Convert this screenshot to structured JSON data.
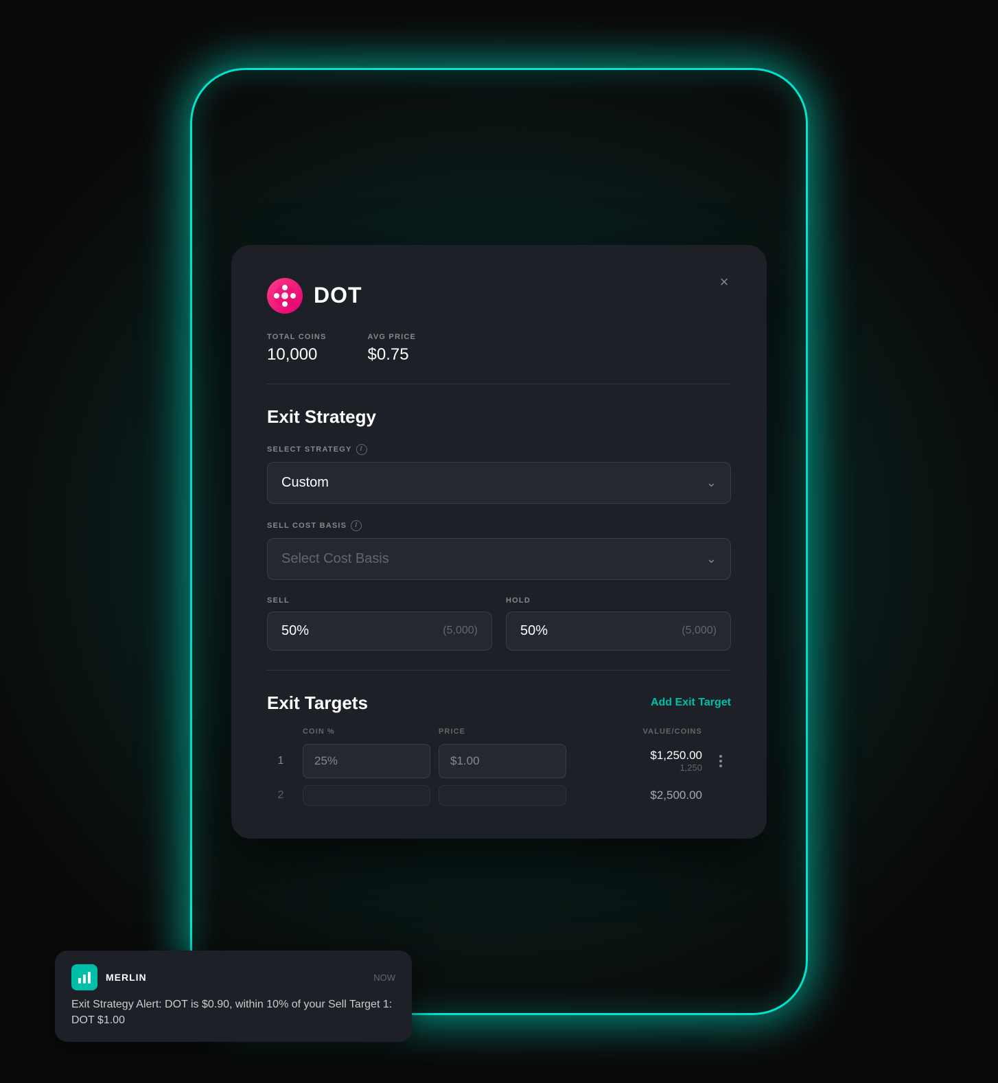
{
  "background": {
    "glow_color": "#00e5cc"
  },
  "modal": {
    "coin": {
      "name": "DOT",
      "logo_alt": "DOT coin logo"
    },
    "stats": {
      "total_coins_label": "TOTAL COINS",
      "total_coins_value": "10,000",
      "avg_price_label": "AVG PRICE",
      "avg_price_value": "$0.75"
    },
    "exit_strategy": {
      "section_title": "Exit Strategy",
      "select_strategy_label": "SELECT STRATEGY",
      "select_strategy_info": "i",
      "strategy_selected": "Custom",
      "sell_cost_basis_label": "SELL COST BASIS",
      "sell_cost_basis_info": "i",
      "cost_basis_placeholder": "Select Cost Basis",
      "sell_label": "SELL",
      "sell_value": "50%",
      "sell_coins": "(5,000)",
      "hold_label": "HOLD",
      "hold_value": "50%",
      "hold_coins": "(5,000)"
    },
    "exit_targets": {
      "section_title": "Exit Targets",
      "add_button": "Add Exit Target",
      "col_coin_pct": "COIN %",
      "col_price": "PRICE",
      "col_value_coins": "VALUE/COINS",
      "rows": [
        {
          "num": "1",
          "coin_pct": "25%",
          "price": "$1.00",
          "value_primary": "$1,250.00",
          "value_secondary": "1,250"
        },
        {
          "num": "2",
          "coin_pct": "",
          "price": "",
          "value_primary": "$2,500.00",
          "value_secondary": ""
        }
      ]
    },
    "close_label": "×"
  },
  "toast": {
    "brand_name": "MERLIN",
    "time": "NOW",
    "message": "Exit Strategy Alert: DOT is $0.90, within 10% of your Sell Target 1: DOT $1.00",
    "icon_alt": "merlin bar chart icon"
  }
}
